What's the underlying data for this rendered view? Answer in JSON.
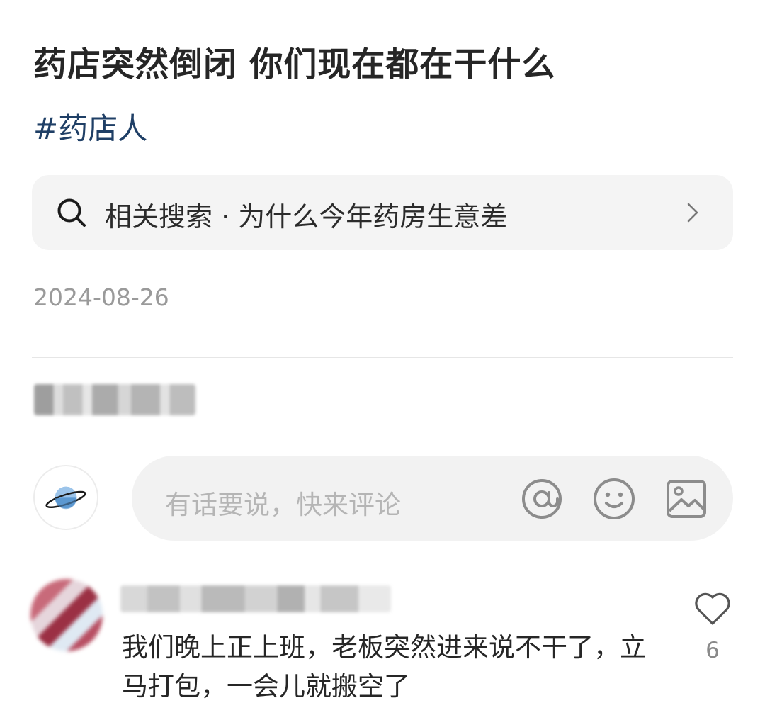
{
  "post": {
    "title": "药店突然倒闭 你们现在都在干什么",
    "topic": "#药店人",
    "date": "2024-08-26"
  },
  "related_search": {
    "label": "相关搜索 · 为什么今年药房生意差"
  },
  "comment_box": {
    "placeholder": "有话要说，快来评论"
  },
  "comments": [
    {
      "text": "我们晚上正上班，老板突然进来说不干了，立马打包，一会儿就搬空了",
      "likes": "6"
    }
  ],
  "icons": {
    "search": "search-icon",
    "chevron": "chevron-right-icon",
    "at": "at-icon",
    "emoji": "emoji-icon",
    "image": "image-icon",
    "heart": "heart-icon",
    "avatar": "planet-avatar"
  },
  "colors": {
    "topic": "#1f3f66",
    "search_bg": "#f4f4f4",
    "input_bg": "#f2f2f2",
    "muted": "#9a9a9a"
  }
}
